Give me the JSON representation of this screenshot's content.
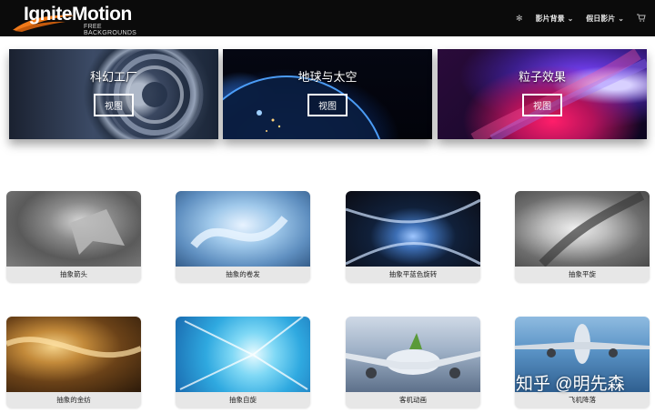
{
  "header": {
    "logo_main": "IgniteMotion",
    "logo_sub": "FREE BACKGROUNDS",
    "nav": {
      "menu1": "影片背景",
      "menu2": "假日影片",
      "settings_icon": "gear-icon",
      "cart_icon": "cart-icon"
    }
  },
  "banners": [
    {
      "title": "科幻工厂",
      "button": "视图"
    },
    {
      "title": "地球与太空",
      "button": "视图"
    },
    {
      "title": "粒子效果",
      "button": "视图"
    }
  ],
  "cards": [
    {
      "label": "抽象箭头"
    },
    {
      "label": "抽象的卷发"
    },
    {
      "label": "抽象平蓝色旋转"
    },
    {
      "label": "抽象平旋"
    },
    {
      "label": "抽象的金纺"
    },
    {
      "label": "抽象自旋"
    },
    {
      "label": "客机动画"
    },
    {
      "label": "飞机降落"
    }
  ],
  "watermark": "知乎 @明先森",
  "colors": {
    "topbar": "#0b0b0b",
    "card_label_bg": "#e7e7e7",
    "logo_swoosh": "#f07a1a"
  }
}
